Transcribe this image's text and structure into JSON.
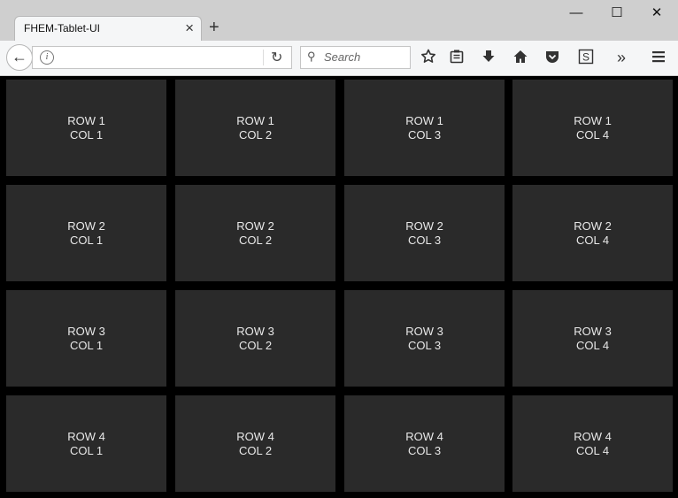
{
  "browser": {
    "tab_title": "FHEM-Tablet-UI",
    "tab_close": "×",
    "new_tab": "+",
    "window_controls": {
      "minimize": "—",
      "maximize": "☐",
      "close": "✕"
    },
    "url": "",
    "search_placeholder": "Search",
    "overflow_label": "»"
  },
  "grid": {
    "cells": [
      [
        "ROW 1",
        "COL 1"
      ],
      [
        "ROW 1",
        "COL 2"
      ],
      [
        "ROW 1",
        "COL 3"
      ],
      [
        "ROW 1",
        "COL 4"
      ],
      [
        "ROW 2",
        "COL 1"
      ],
      [
        "ROW 2",
        "COL 2"
      ],
      [
        "ROW 2",
        "COL 3"
      ],
      [
        "ROW 2",
        "COL 4"
      ],
      [
        "ROW 3",
        "COL 1"
      ],
      [
        "ROW 3",
        "COL 2"
      ],
      [
        "ROW 3",
        "COL 3"
      ],
      [
        "ROW 3",
        "COL 4"
      ],
      [
        "ROW 4",
        "COL 1"
      ],
      [
        "ROW 4",
        "COL 2"
      ],
      [
        "ROW 4",
        "COL 3"
      ],
      [
        "ROW 4",
        "COL 4"
      ]
    ]
  }
}
